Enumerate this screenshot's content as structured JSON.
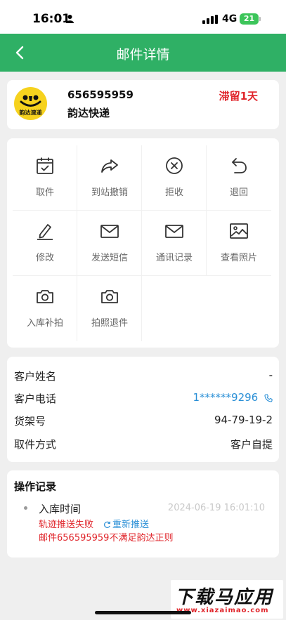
{
  "status_bar": {
    "time": "16:01",
    "network": "4G",
    "battery": "21"
  },
  "nav": {
    "title": "邮件详情"
  },
  "parcel": {
    "logo_text": "韵达速递",
    "tracking_no": "656595959",
    "courier": "韵达快递",
    "stay_status": "滞留1天"
  },
  "actions": [
    {
      "label": "取件",
      "icon": "checkbox-calendar-icon"
    },
    {
      "label": "到站撤销",
      "icon": "share-arrow-icon"
    },
    {
      "label": "拒收",
      "icon": "x-circle-icon"
    },
    {
      "label": "退回",
      "icon": "undo-icon"
    },
    {
      "label": "修改",
      "icon": "pencil-icon"
    },
    {
      "label": "发送短信",
      "icon": "mail-icon"
    },
    {
      "label": "通讯记录",
      "icon": "mail-icon"
    },
    {
      "label": "查看照片",
      "icon": "image-icon"
    },
    {
      "label": "入库补拍",
      "icon": "camera-icon"
    },
    {
      "label": "拍照退件",
      "icon": "camera-icon"
    }
  ],
  "info": {
    "name_label": "客户姓名",
    "name_value": "-",
    "phone_label": "客户电话",
    "phone_value": "1******9296",
    "shelf_label": "货架号",
    "shelf_value": "94-79-19-2",
    "pickup_label": "取件方式",
    "pickup_value": "客户自提"
  },
  "log": {
    "title": "操作记录",
    "event": "入库时间",
    "time": "2024-06-19 16:01:10",
    "fail_text": "轨迹推送失败",
    "retry_label": "重新推送",
    "rule_text": "邮件656595959不满足韵达正则"
  },
  "watermark": {
    "title": "下载马应用",
    "url": "www.xiazaimao.com"
  },
  "colors": {
    "brand_green": "#2fb065",
    "alert_red": "#e0252b",
    "link_blue": "#2a8fd6"
  }
}
